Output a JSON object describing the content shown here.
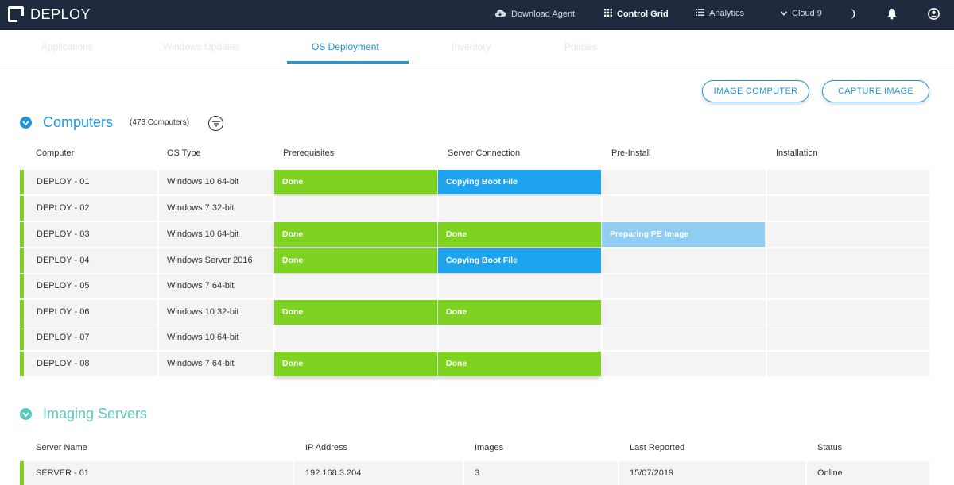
{
  "topbar": {
    "app_name": "DEPLOY",
    "nav": [
      {
        "label": "Download Agent",
        "icon": "cloud-download-icon"
      },
      {
        "label": "Control Grid",
        "icon": "grid-icon"
      },
      {
        "label": "Analytics",
        "icon": "list-icon"
      },
      {
        "label": "Cloud 9",
        "icon": "chevron-down-icon"
      }
    ],
    "icons": [
      "moon-icon",
      "bell-icon",
      "user-icon"
    ]
  },
  "tabs": [
    {
      "label": "Applications",
      "active": false
    },
    {
      "label": "Windows Updates",
      "active": false
    },
    {
      "label": "OS Deployment",
      "active": true
    },
    {
      "label": "Inventory",
      "active": false
    },
    {
      "label": "Policies",
      "active": false
    }
  ],
  "actions": {
    "image_computer": "IMAGE COMPUTER",
    "capture_image": "CAPTURE IMAGE"
  },
  "computers": {
    "title": "Computers",
    "count": "(473 Computers)",
    "columns": [
      "Computer",
      "OS Type",
      "Prerequisites",
      "Server Connection",
      "Pre-Install",
      "Installation"
    ],
    "rows": [
      {
        "name": "DEPLOY - 01",
        "os": "Windows 10 64-bit",
        "prerequisites": "Done",
        "server_connection": "Copying Boot File",
        "pre_install": "",
        "installation": ""
      },
      {
        "name": "DEPLOY - 02",
        "os": "Windows 7 32-bit",
        "prerequisites": "",
        "server_connection": "",
        "pre_install": "",
        "installation": ""
      },
      {
        "name": "DEPLOY - 03",
        "os": "Windows 10 64-bit",
        "prerequisites": "Done",
        "server_connection": "Done",
        "pre_install": "Preparing PE Image",
        "installation": ""
      },
      {
        "name": "DEPLOY - 04",
        "os": "Windows Server 2016",
        "prerequisites": "Done",
        "server_connection": "Copying Boot File",
        "pre_install": "",
        "installation": ""
      },
      {
        "name": "DEPLOY - 05",
        "os": "Windows 7 64-bit",
        "prerequisites": "",
        "server_connection": "",
        "pre_install": "",
        "installation": ""
      },
      {
        "name": "DEPLOY - 06",
        "os": "Windows 10 32-bit",
        "prerequisites": "Done",
        "server_connection": "Done",
        "pre_install": "",
        "installation": ""
      },
      {
        "name": "DEPLOY - 07",
        "os": "Windows 10 64-bit",
        "prerequisites": "",
        "server_connection": "",
        "pre_install": "",
        "installation": ""
      },
      {
        "name": "DEPLOY - 08",
        "os": "Windows 7 64-bit",
        "prerequisites": "Done",
        "server_connection": "Done",
        "pre_install": "",
        "installation": ""
      }
    ]
  },
  "imaging_servers": {
    "title": "Imaging Servers",
    "columns": [
      "Server Name",
      "IP Address",
      "Images",
      "Last Reported",
      "Status"
    ],
    "rows": [
      {
        "name": "SERVER - 01",
        "ip": "192.168.3.204",
        "images": "3",
        "last_reported": "15/07/2019",
        "status": "Online"
      }
    ]
  },
  "colors": {
    "topbar": "#1f2a3f",
    "accent_blue": "#2196d8",
    "done_green": "#7ed321",
    "copying_blue": "#1ea4ef",
    "preparing_light_blue": "#8fcdf3",
    "servers_teal": "#5cc9c0"
  }
}
